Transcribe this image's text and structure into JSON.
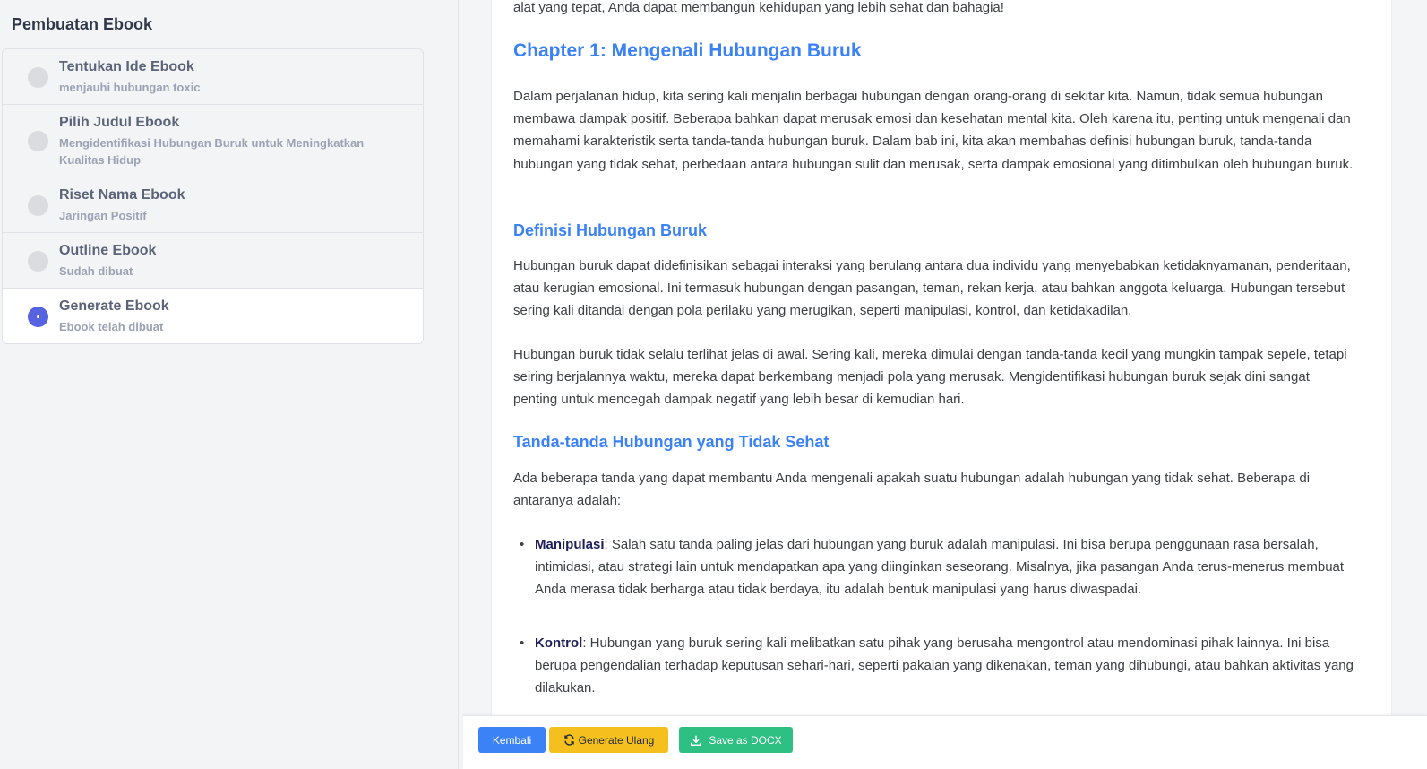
{
  "sidebar": {
    "title": "Pembuatan Ebook",
    "steps": [
      {
        "title": "Tentukan Ide Ebook",
        "subtitle": "menjauhi hubungan toxic"
      },
      {
        "title": "Pilih Judul Ebook",
        "subtitle": "Mengidentifikasi Hubungan Buruk untuk Meningkatkan Kualitas Hidup"
      },
      {
        "title": "Riset Nama Ebook",
        "subtitle": "Jaringan Positif"
      },
      {
        "title": "Outline Ebook",
        "subtitle": "Sudah dibuat"
      },
      {
        "title": "Generate Ebook",
        "subtitle": "Ebook telah dibuat"
      }
    ]
  },
  "article": {
    "intro_tail": "alat yang tepat, Anda dapat membangun kehidupan yang lebih sehat dan bahagia!",
    "chapter_title": "Chapter 1: Mengenali Hubungan Buruk",
    "chapter_intro": "Dalam perjalanan hidup, kita sering kali menjalin berbagai hubungan dengan orang-orang di sekitar kita. Namun, tidak semua hubungan membawa dampak positif. Beberapa bahkan dapat merusak emosi dan kesehatan mental kita. Oleh karena itu, penting untuk mengenali dan memahami karakteristik serta tanda-tanda hubungan buruk. Dalam bab ini, kita akan membahas definisi hubungan buruk, tanda-tanda hubungan yang tidak sehat, perbedaan antara hubungan sulit dan merusak, serta dampak emosional yang ditimbulkan oleh hubungan buruk.",
    "section1_title": "Definisi Hubungan Buruk",
    "section1_p1": "Hubungan buruk dapat didefinisikan sebagai interaksi yang berulang antara dua individu yang menyebabkan ketidaknyamanan, penderitaan, atau kerugian emosional. Ini termasuk hubungan dengan pasangan, teman, rekan kerja, atau bahkan anggota keluarga. Hubungan tersebut sering kali ditandai dengan pola perilaku yang merugikan, seperti manipulasi, kontrol, dan ketidakadilan.",
    "section1_p2": "Hubungan buruk tidak selalu terlihat jelas di awal. Sering kali, mereka dimulai dengan tanda-tanda kecil yang mungkin tampak sepele, tetapi seiring berjalannya waktu, mereka dapat berkembang menjadi pola yang merusak. Mengidentifikasi hubungan buruk sejak dini sangat penting untuk mencegah dampak negatif yang lebih besar di kemudian hari.",
    "section2_title": "Tanda-tanda Hubungan yang Tidak Sehat",
    "section2_p1": "Ada beberapa tanda yang dapat membantu Anda mengenali apakah suatu hubungan adalah hubungan yang tidak sehat. Beberapa di antaranya adalah:",
    "bullets": [
      {
        "term": "Manipulasi",
        "text": ": Salah satu tanda paling jelas dari hubungan yang buruk adalah manipulasi. Ini bisa berupa penggunaan rasa bersalah, intimidasi, atau strategi lain untuk mendapatkan apa yang diinginkan seseorang. Misalnya, jika pasangan Anda terus-menerus membuat Anda merasa tidak berharga atau tidak berdaya, itu adalah bentuk manipulasi yang harus diwaspadai."
      },
      {
        "term": "Kontrol",
        "text": ": Hubungan yang buruk sering kali melibatkan satu pihak yang berusaha mengontrol atau mendominasi pihak lainnya. Ini bisa berupa pengendalian terhadap keputusan sehari-hari, seperti pakaian yang dikenakan, teman yang dihubungi, atau bahkan aktivitas yang dilakukan."
      }
    ]
  },
  "toolbar": {
    "back_label": "Kembali",
    "regenerate_label": "Generate Ulang",
    "save_label": "Save as DOCX"
  },
  "colors": {
    "accent_blue": "#3b82f6",
    "active_step": "#5663e0",
    "warning_yellow": "#f5c01d",
    "success_green": "#2ebf82"
  }
}
